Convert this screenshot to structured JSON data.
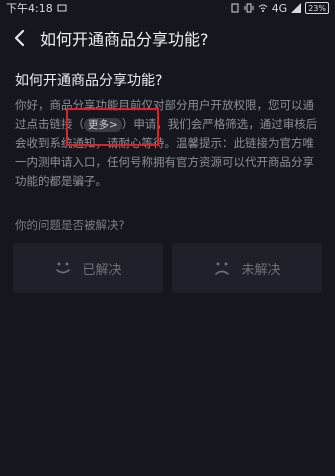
{
  "status_bar": {
    "time": "下午4:18",
    "network": "4G",
    "battery": "23%"
  },
  "nav": {
    "title": "如何开通商品分享功能?"
  },
  "content": {
    "question": "如何开通商品分享功能?",
    "answer_part1": "你好，商品分享功能目前仅对部分用户开放权限，您可以通过点击链接",
    "more_label": "更多>",
    "answer_part2": "申请，我们会严格筛选，通过审核后会收到系统通知，请耐心等待。温馨提示：此链接为官方唯一内测申请入口，任何号称拥有官方资源可以代开商品分享功能的都是骗子。"
  },
  "feedback": {
    "prompt": "你的问题是否被解决?",
    "solved_label": "已解决",
    "unsolved_label": "未解决"
  },
  "colors": {
    "background": "#16161f",
    "highlight_border": "#d9232c"
  }
}
